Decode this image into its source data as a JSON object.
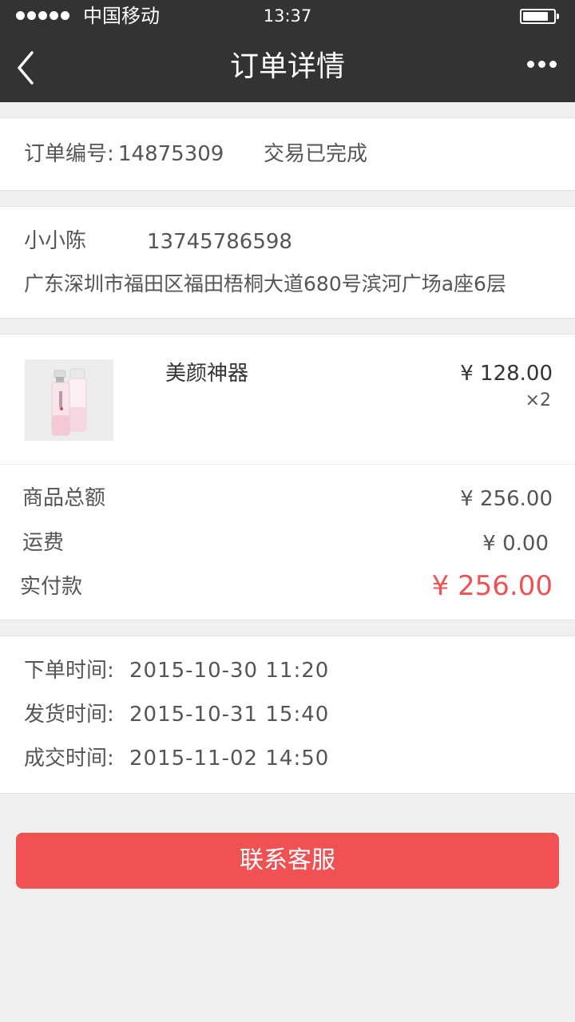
{
  "status_bar": {
    "carrier": "中国移动",
    "time": "13:37",
    "signal_icon": "signal-dots-icon",
    "battery_icon": "battery-icon",
    "battery_level": 0.85
  },
  "nav": {
    "title": "订单详情",
    "back_icon": "chevron-left-icon",
    "more_icon": "more-dots-icon"
  },
  "order": {
    "number_label": "订单编号:",
    "number": "14875309",
    "status": "交易已完成"
  },
  "recipient": {
    "name": "小小陈",
    "phone": "13745786598",
    "address": "广东深圳市福田区福田梧桐大道680号滨河广场a座6层"
  },
  "goods": {
    "name": "美颜神器",
    "price": "¥ 128.00",
    "quantity": "×2",
    "image_icon": "product-bottles-image"
  },
  "summary": {
    "subtotal_label": "商品总额",
    "subtotal": "¥ 256.00",
    "shipping_label": "运费",
    "shipping": "¥ 0.00",
    "paid_label": "实付款",
    "paid": "¥ 256.00"
  },
  "times": {
    "order_label": "下单时间:",
    "order_time": "2015-10-30 11:20",
    "ship_label": "发货时间:",
    "ship_time": "2015-10-31 15:40",
    "deal_label": "成交时间:",
    "deal_time": "2015-11-02 14:50"
  },
  "action": {
    "contact_label": "联系客服"
  },
  "colors": {
    "header_bg": "#333333",
    "accent_red": "#f05152",
    "page_bg": "#efefef"
  }
}
